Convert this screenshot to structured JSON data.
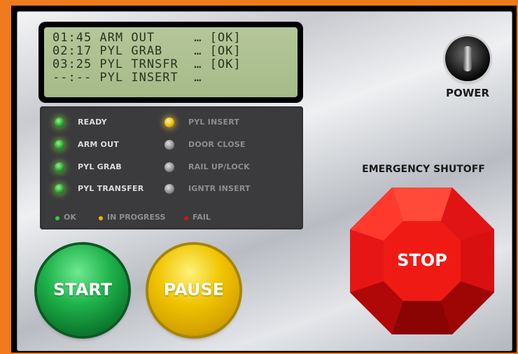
{
  "display": {
    "lines": [
      "01:45 ARM OUT     … [OK]",
      "02:17 PYL GRAB    … [OK]",
      "03:25 PYL TRNSFR  … [OK]",
      "--:-- PYL INSERT  …"
    ]
  },
  "indicators": [
    {
      "label": "READY",
      "state": "green"
    },
    {
      "label": "ARM OUT",
      "state": "green"
    },
    {
      "label": "PYL GRAB",
      "state": "green"
    },
    {
      "label": "PYL TRANSFER",
      "state": "green"
    },
    {
      "label": "PYL INSERT",
      "state": "yellow"
    },
    {
      "label": "DOOR CLOSE",
      "state": "grey"
    },
    {
      "label": "RAIL UP/LOCK",
      "state": "grey"
    },
    {
      "label": "IGNTR INSERT",
      "state": "grey"
    }
  ],
  "legend": {
    "ok": "OK",
    "in_progress": "IN PROGRESS",
    "fail": "FAIL",
    "colors": {
      "ok": "#2ecc40",
      "in_progress": "#f2b400",
      "fail": "#e01010"
    }
  },
  "power": {
    "label": "POWER"
  },
  "emergency": {
    "label": "EMERGENCY SHUTOFF",
    "stop_label": "STOP"
  },
  "controls": {
    "start_label": "START",
    "pause_label": "PAUSE"
  },
  "colors": {
    "background": "#f07a1e",
    "lcd": "#b0c293",
    "stop": "#e01414",
    "start": "#1fb34c",
    "pause": "#f0c400"
  }
}
